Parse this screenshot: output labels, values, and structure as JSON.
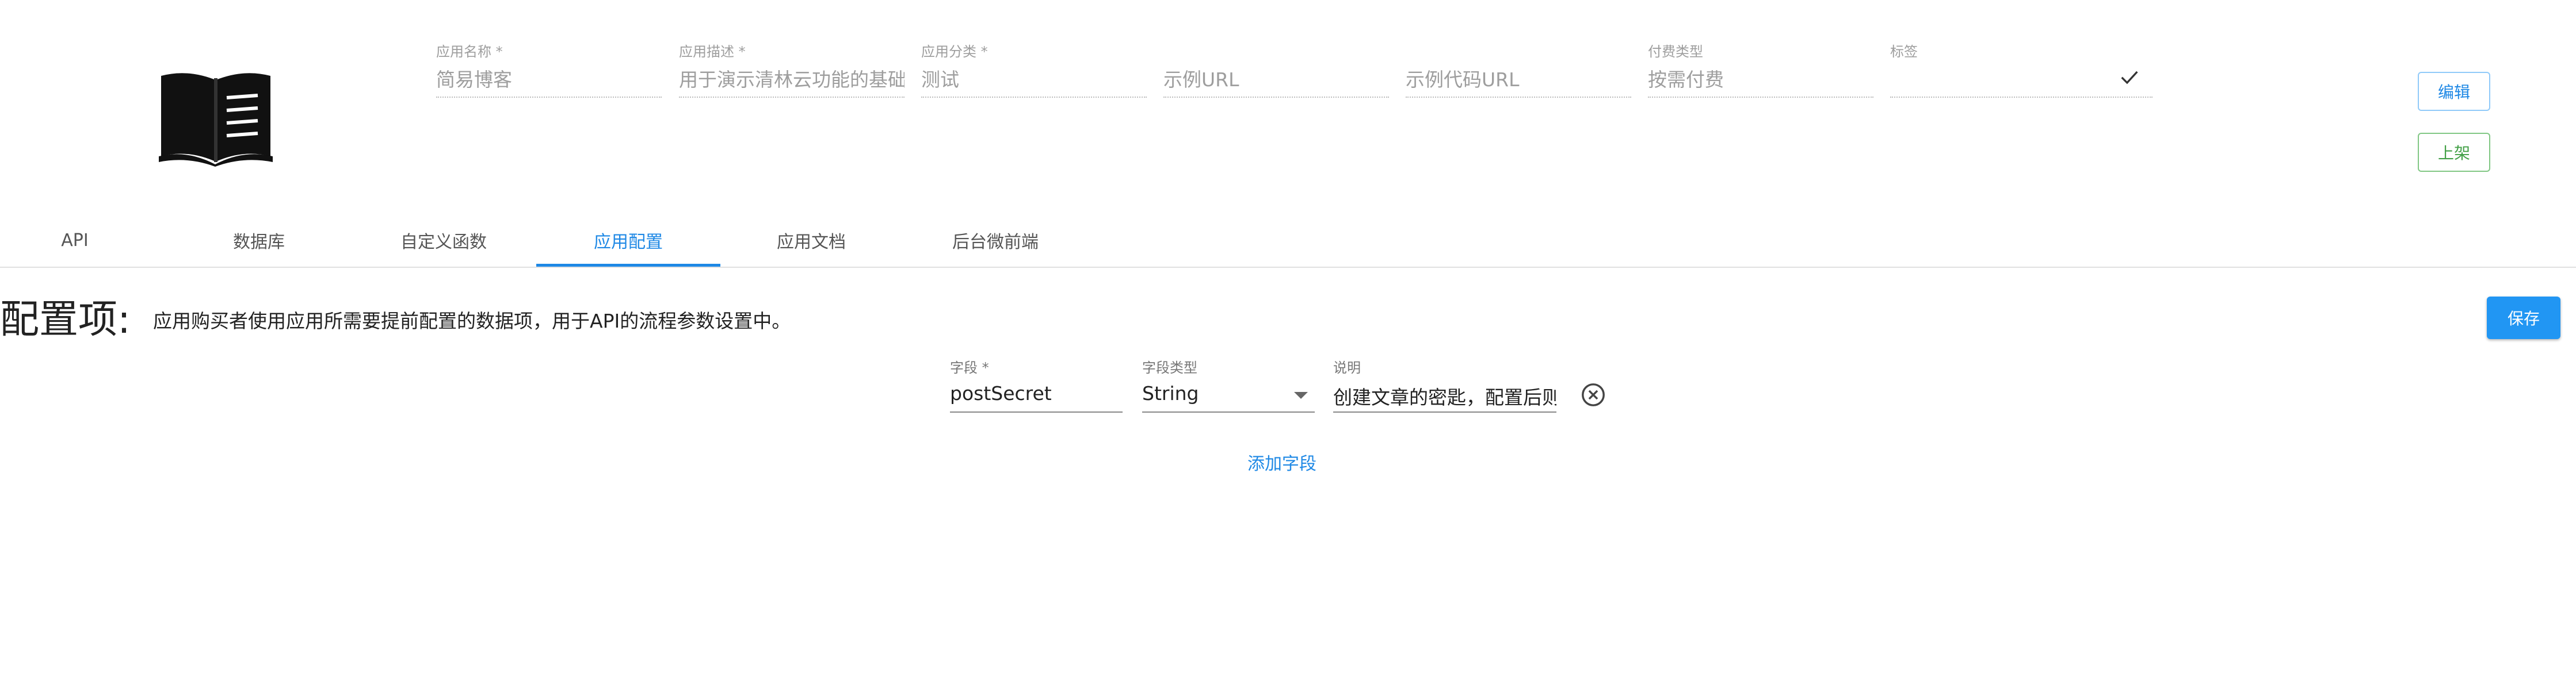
{
  "header": {
    "fields": [
      {
        "label": "应用名称 *",
        "value": "简易博客"
      },
      {
        "label": "应用描述 *",
        "value": "用于演示清林云功能的基础"
      },
      {
        "label": "应用分类 *",
        "value": "测试"
      },
      {
        "label": "",
        "value": "示例URL"
      },
      {
        "label": "",
        "value": "示例代码URL"
      },
      {
        "label": "付费类型",
        "value": "按需付费"
      },
      {
        "label": "标签",
        "value": ""
      }
    ],
    "edit_label": "编辑",
    "list_label": "上架"
  },
  "tabs": [
    {
      "label": "API"
    },
    {
      "label": "数据库"
    },
    {
      "label": "自定义函数"
    },
    {
      "label": "应用配置",
      "active": true
    },
    {
      "label": "应用文档"
    },
    {
      "label": "后台微前端"
    }
  ],
  "config": {
    "title": "配置项:",
    "description": "应用购买者使用应用所需要提前配置的数据项，用于API的流程参数设置中。",
    "save_label": "保存",
    "fields": [
      {
        "name_label": "字段 *",
        "name_value": "postSecret",
        "type_label": "字段类型",
        "type_value": "String",
        "desc_label": "说明",
        "desc_value": "创建文章的密匙，配置后则"
      }
    ],
    "add_field_label": "添加字段"
  },
  "colors": {
    "accent": "#1e88e5",
    "success": "#43a047",
    "primary_button": "#2196f3"
  }
}
